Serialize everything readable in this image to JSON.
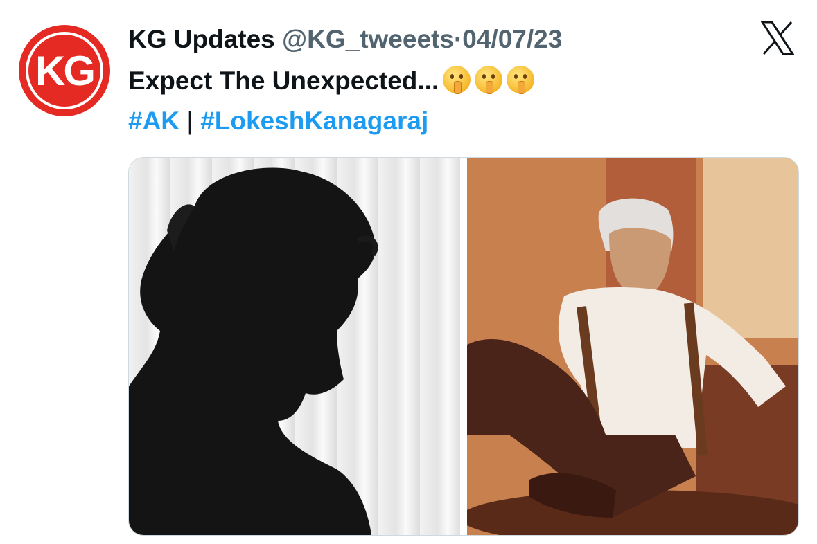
{
  "tweet": {
    "author_name": "KG Updates",
    "handle": "@KG_tweeets",
    "separator": "·",
    "date": "04/07/23",
    "text": "Expect The Unexpected...",
    "emoji_count": 3,
    "hashtags": [
      "#AK",
      "#LokeshKanagaraj"
    ],
    "hashtag_separator": "|"
  },
  "avatar": {
    "text": "KG",
    "color": "#e42a22"
  },
  "icons": {
    "platform": "x-logo-icon",
    "emoji": "shushing-face-emoji"
  },
  "colors": {
    "hashtag": "#1d9bf0",
    "muted": "#536471",
    "text": "#0f1419"
  }
}
